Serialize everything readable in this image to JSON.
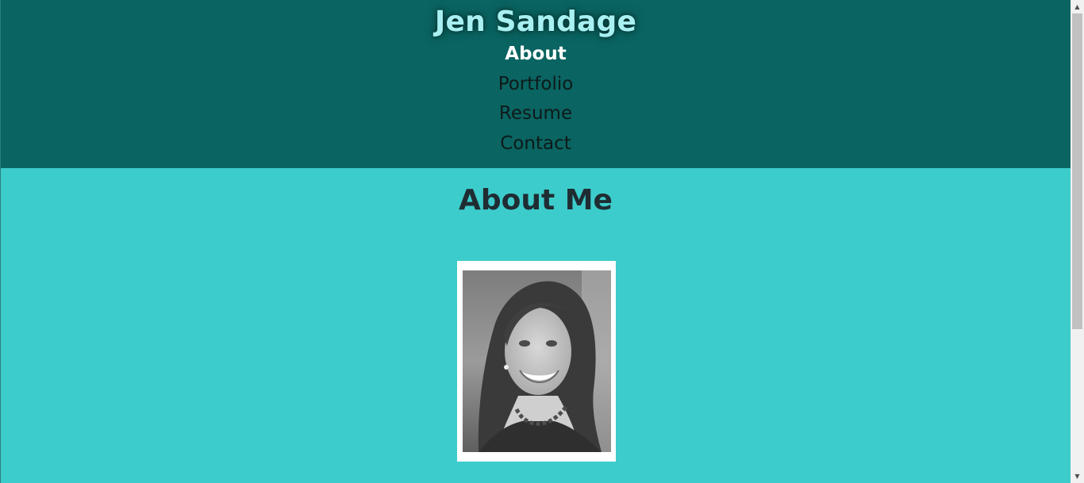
{
  "header": {
    "site_title": "Jen Sandage",
    "nav": [
      {
        "label": "About",
        "active": true
      },
      {
        "label": "Portfolio",
        "active": false
      },
      {
        "label": "Resume",
        "active": false
      },
      {
        "label": "Contact",
        "active": false
      }
    ]
  },
  "main": {
    "heading": "About Me",
    "profile_photo": "profile-photo"
  },
  "colors": {
    "header_bg": "#0a6461",
    "page_bg": "#3ccccb",
    "title_text": "#a8f0f2",
    "active_nav": "#ffffff",
    "nav_text": "#0d1a1a",
    "heading_text": "#1f2d33"
  },
  "scrollbar": {
    "up_icon": "scroll-up-arrow-icon",
    "down_icon": "scroll-down-arrow-icon"
  }
}
